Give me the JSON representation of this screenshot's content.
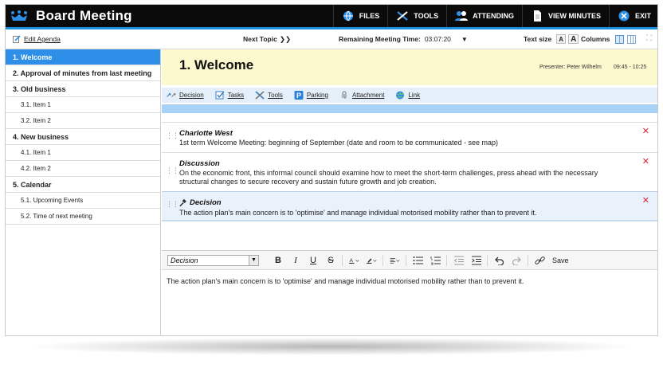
{
  "app": {
    "title": "Board Meeting"
  },
  "nav": [
    {
      "label": "FILES",
      "icon": "globe-icon"
    },
    {
      "label": "TOOLS",
      "icon": "tools-icon"
    },
    {
      "label": "ATTENDING",
      "icon": "people-icon"
    },
    {
      "label": "VIEW MINUTES",
      "icon": "document-icon"
    },
    {
      "label": "EXIT",
      "icon": "close-circle-icon"
    }
  ],
  "toolbar": {
    "edit_agenda": "Edit Agenda",
    "next_topic": "Next Topic",
    "next_topic_glyph": "❯❯",
    "remaining_label": "Remaining Meeting Time:",
    "remaining_value": "03:07:20",
    "text_size_label": "Text size",
    "text_size_small": "A",
    "text_size_large": "A",
    "columns_label": "Columns"
  },
  "sidebar": {
    "items": [
      {
        "label": "1. Welcome",
        "level": 1,
        "active": true
      },
      {
        "label": "2. Approval of minutes from last meeting",
        "level": 1
      },
      {
        "label": "3. Old business",
        "level": 1
      },
      {
        "label": "3.1. Item 1",
        "level": 2
      },
      {
        "label": "3.2. Item 2",
        "level": 2
      },
      {
        "label": "4. New business",
        "level": 1
      },
      {
        "label": "4.1. Item 1",
        "level": 2
      },
      {
        "label": "4.2. Item 2",
        "level": 2
      },
      {
        "label": "5. Calendar",
        "level": 1
      },
      {
        "label": "5.1. Upcoming Events",
        "level": 2
      },
      {
        "label": "5.2. Time of next meeting",
        "level": 2
      }
    ]
  },
  "topic": {
    "title": "1. Welcome",
    "presenter": "Presenter: Peter Wilhelm",
    "time": "09:45 - 10:25"
  },
  "actions": [
    {
      "label": "Decision",
      "icon": "gavel-icon"
    },
    {
      "label": "Tasks",
      "icon": "checkbox-icon"
    },
    {
      "label": "Tools",
      "icon": "tools-icon"
    },
    {
      "label": "Parking",
      "icon": "parking-icon"
    },
    {
      "label": "Attachment",
      "icon": "paperclip-icon"
    },
    {
      "label": "Link",
      "icon": "globe-icon"
    }
  ],
  "entries": [
    {
      "title": "Charlotte West",
      "body": "1st term Welcome Meeting: beginning of September (date and room to be communicated - see map)"
    },
    {
      "title": "Discussion",
      "body": "On the economic front, this informal council should examine how to meet the short-term challenges, press ahead with the necessary structural changes to secure recovery and sustain future growth and job creation."
    },
    {
      "title": "Decision",
      "body": "The action plan's main concern is to 'optimise' and manage individual motorised mobility rather than to prevent it."
    }
  ],
  "editor": {
    "style_value": "Decision",
    "save_label": "Save",
    "content": "The action plan's main concern is to 'optimise' and manage individual motorised mobility rather than to prevent it."
  },
  "colors": {
    "accent": "#2d8fe8",
    "topic_bg": "#fdf9cf",
    "delete": "#d22233"
  }
}
